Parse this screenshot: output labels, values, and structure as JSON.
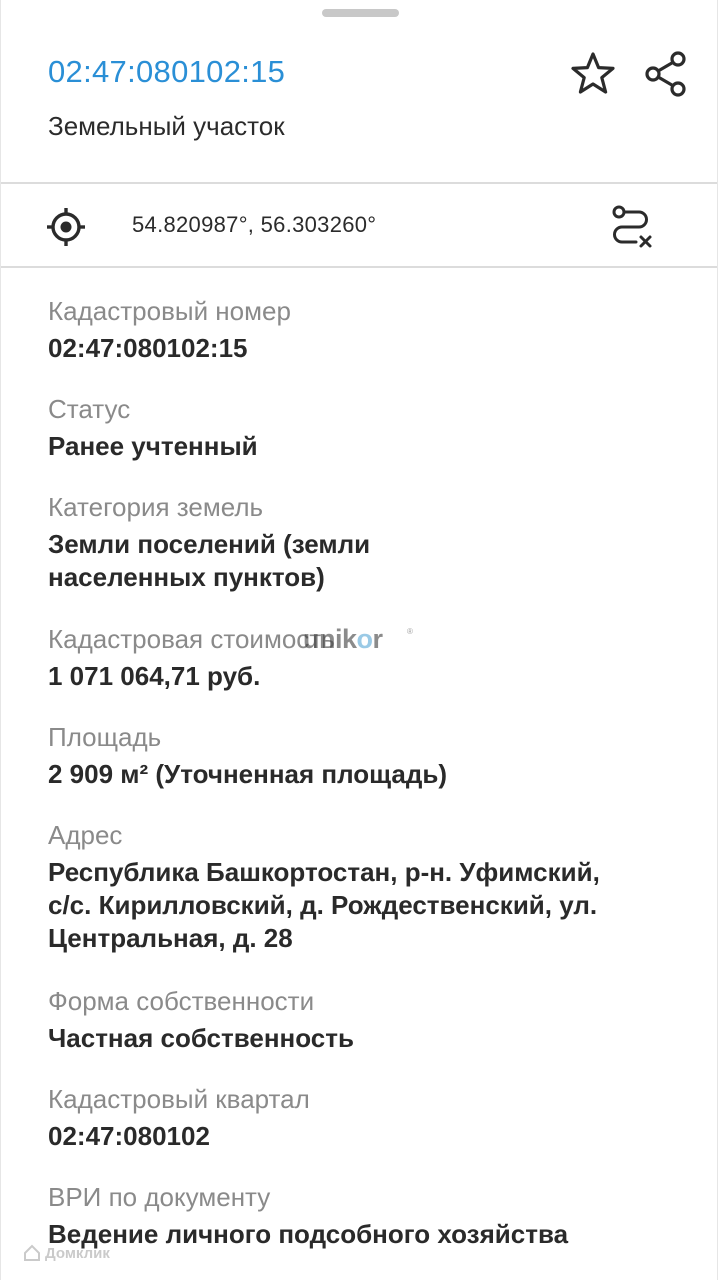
{
  "header": {
    "title": "02:47:080102:15",
    "subtitle": "Земельный участок"
  },
  "coordinates": {
    "text": "54.820987°, 56.303260°"
  },
  "details": {
    "cadastral_number": {
      "label": "Кадастровый номер",
      "value": "02:47:080102:15"
    },
    "status": {
      "label": "Статус",
      "value": "Ранее учтенный"
    },
    "land_category": {
      "label": "Категория земель",
      "value_line1": "Земли поселений (земли",
      "value_line2": "населенных пунктов)"
    },
    "cadastral_cost": {
      "label": "Кадастровая стоимость",
      "value": "1 071 064,71 руб."
    },
    "area": {
      "label": "Площадь",
      "value": "2 909 м² (Уточненная площадь)"
    },
    "address": {
      "label": "Адрес",
      "value_line1": "Республика Башкортостан, р-н. Уфимский,",
      "value_line2": "с/с. Кирилловский, д. Рождественский, ул.",
      "value_line3": "Центральная, д. 28"
    },
    "ownership": {
      "label": "Форма собственности",
      "value": "Частная собственность"
    },
    "cadastral_quarter": {
      "label": "Кадастровый квартал",
      "value": "02:47:080102"
    },
    "permitted_use": {
      "label": "ВРИ по документу",
      "value": "Ведение личного подсобного хозяйства"
    }
  },
  "watermark": {
    "pre": "unik",
    "o": "o",
    "post": "r"
  },
  "bottom_watermark": {
    "text": "Домклик"
  },
  "colors": {
    "accent": "#2a8fd6",
    "label": "#8a8a8a",
    "value": "#2a2a2a",
    "divider": "#dcdcdc"
  },
  "icons": [
    "star-icon",
    "share-icon",
    "crosshair-icon",
    "route-icon"
  ]
}
